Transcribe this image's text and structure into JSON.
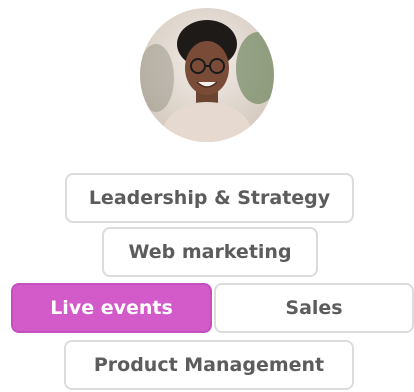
{
  "profile": {
    "avatar_description": "person-photo"
  },
  "topics": [
    {
      "label": "Leadership & Strategy",
      "selected": false
    },
    {
      "label": "Web marketing",
      "selected": false
    },
    {
      "label": "Live events",
      "selected": true
    },
    {
      "label": "Sales",
      "selected": false
    },
    {
      "label": "Product Management",
      "selected": false
    }
  ],
  "colors": {
    "selected_chip": "#d35ac9",
    "chip_border": "#dcdcdc",
    "chip_text": "#5c5c5c"
  }
}
